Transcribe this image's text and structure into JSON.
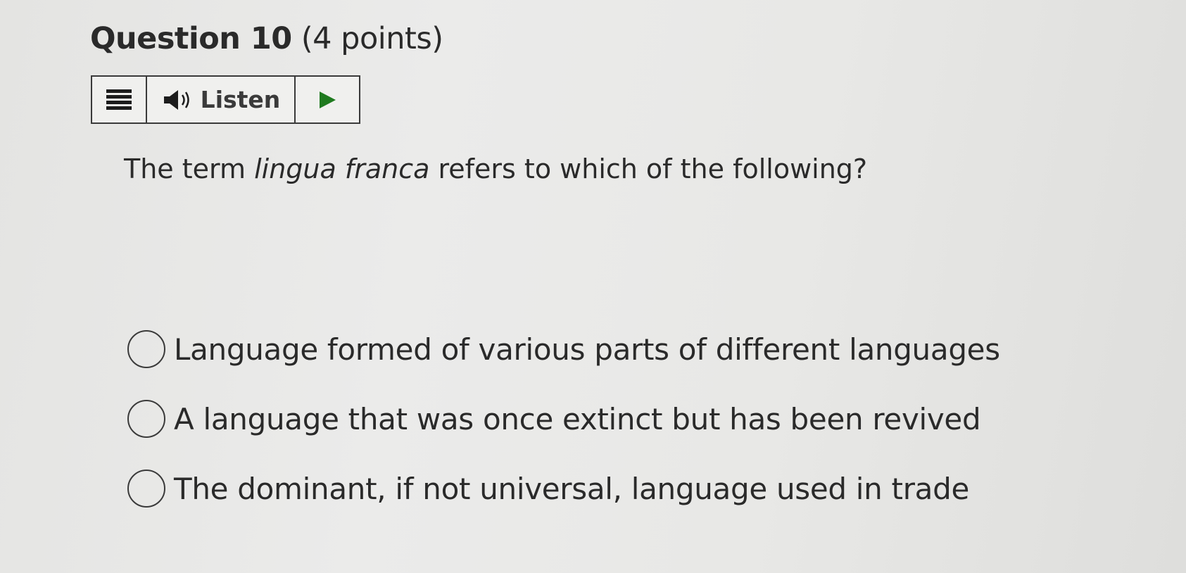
{
  "question": {
    "number_label": "Question 10",
    "points_label": "(4 points)"
  },
  "toolbar": {
    "menu_icon": "hamburger-menu-icon",
    "speaker_icon": "speaker-icon",
    "listen_label": "Listen",
    "play_icon": "play-icon",
    "play_color": "#1f7a1f"
  },
  "prompt": {
    "prefix": "The term ",
    "term": "lingua franca",
    "suffix": " refers to which of the following?"
  },
  "options": [
    {
      "label": "Language formed of various parts of different languages",
      "selected": false
    },
    {
      "label": "A language that was once extinct but has been revived",
      "selected": false
    },
    {
      "label": "The dominant, if not universal, language used in trade",
      "selected": false
    }
  ]
}
